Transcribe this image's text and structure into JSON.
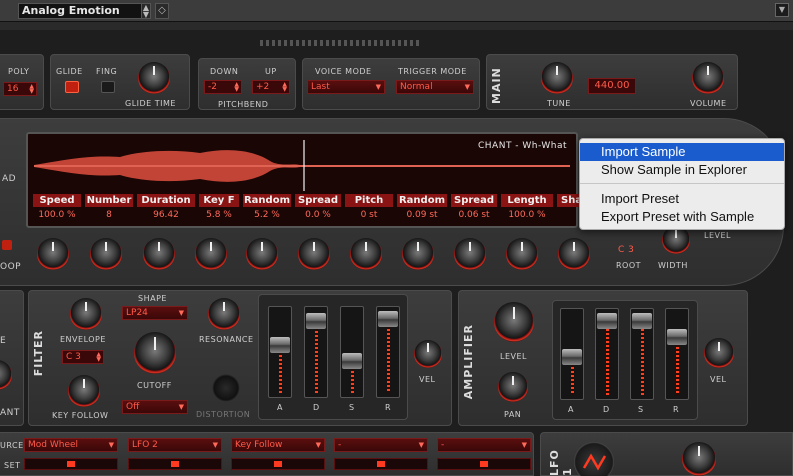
{
  "toolbar": {
    "preset_name": "Analog Emotion"
  },
  "voice": {
    "poly_label": "POLY",
    "poly_value": "16",
    "glide_label": "GLIDE",
    "fing_label": "FING",
    "glide_time_label": "GLIDE TIME",
    "down_label": "DOWN",
    "down_value": "-2",
    "up_label": "UP",
    "up_value": "+2",
    "pitchbend_label": "PITCHBEND",
    "voice_mode_label": "VOICE MODE",
    "voice_mode_value": "Last",
    "trigger_mode_label": "TRIGGER MODE",
    "trigger_mode_value": "Normal"
  },
  "main": {
    "title": "MAIN",
    "tune_label": "TUNE",
    "tune_value": "440.00",
    "volume_label": "VOLUME"
  },
  "sample": {
    "name": "CHANT - Wh-What",
    "params": [
      {
        "label": "Speed",
        "value": "100.0 %"
      },
      {
        "label": "Number",
        "value": "8"
      },
      {
        "label": "Duration",
        "value": "96.42"
      },
      {
        "label": "Key F",
        "value": "5.8 %"
      },
      {
        "label": "Random",
        "value": "5.2 %"
      },
      {
        "label": "Spread",
        "value": "0.0 %"
      },
      {
        "label": "Pitch",
        "value": "0 st"
      },
      {
        "label": "Random",
        "value": "0.09 st"
      },
      {
        "label": "Spread",
        "value": "0.06 st"
      },
      {
        "label": "Length",
        "value": "100.0 %"
      },
      {
        "label": "Sha",
        "value": ""
      }
    ],
    "root_label": "ROOT",
    "root_value": "C 3",
    "width_label": "WIDTH",
    "level_label": "LEVEL",
    "left_cut_1": "AD",
    "left_cut_2": "OOP"
  },
  "context_menu": {
    "items": [
      "Import Sample",
      "Show Sample in Explorer",
      "Import Preset",
      "Export Preset with Sample"
    ]
  },
  "filter": {
    "title": "FILTER",
    "shape_label": "SHAPE",
    "shape_value": "LP24",
    "envelope_label": "ENVELOPE",
    "envelope_value": "C 3",
    "key_follow_label": "KEY FOLLOW",
    "cutoff_label": "CUTOFF",
    "resonance_label": "RESONANCE",
    "distortion_label": "DISTORTION",
    "distortion_value": "Off",
    "adsr": [
      "A",
      "D",
      "S",
      "R"
    ],
    "vel_label": "VEL"
  },
  "amplifier": {
    "title": "AMPLIFIER",
    "level_label": "LEVEL",
    "pan_label": "PAN",
    "adsr": [
      "A",
      "D",
      "S",
      "R"
    ],
    "vel_label": "VEL"
  },
  "mod": {
    "source_label": "URCE",
    "set_label": "SET",
    "sources": [
      "Mod Wheel",
      "LFO 2",
      "Key Follow",
      "-",
      "-"
    ]
  },
  "lfo": {
    "title": "LFO 1"
  },
  "left_cut": {
    "e": "E",
    "ant": "ANT"
  }
}
